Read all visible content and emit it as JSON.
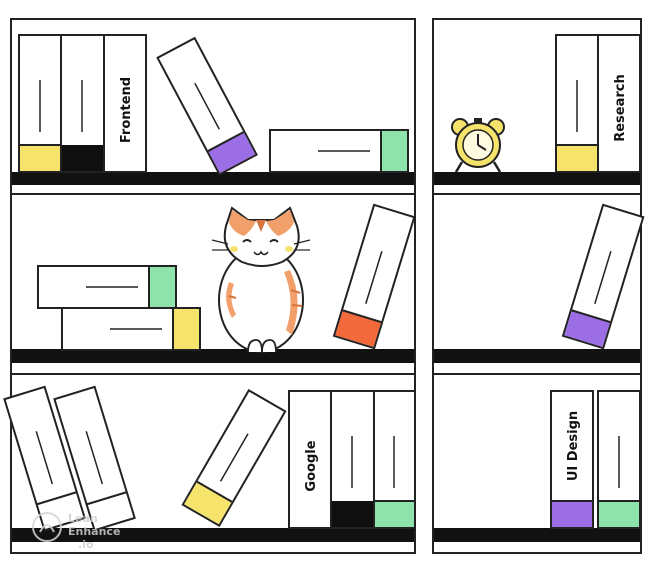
{
  "book_labels": {
    "frontend": "Frontend",
    "research": "Research",
    "google": "Google",
    "ui_design": "UI Design"
  },
  "watermark": {
    "line1": "Lean",
    "line2": "Enhance",
    "line3": ".io"
  },
  "colors": {
    "outline": "#222222",
    "shelf": "#111111",
    "yellow": "#f6e36b",
    "purple": "#9b6ee6",
    "green": "#8ee2ac",
    "orange": "#f26a3b",
    "black": "#0f0f0f",
    "cat_orange": "#f2a06b",
    "cat_stripe": "#d7743c"
  },
  "icons": [
    "alarm-clock-icon",
    "cat-illustration",
    "watermark-logo-icon"
  ]
}
